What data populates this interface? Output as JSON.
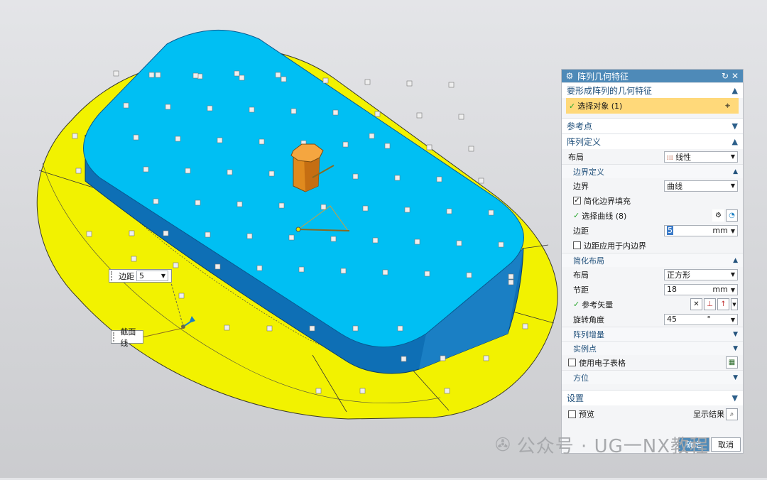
{
  "dialog": {
    "title": "阵列几何特征",
    "sections": {
      "features": "要形成阵列的几何特征",
      "select_object": "选择对象 (1)",
      "reference_point": "参考点",
      "array_definition": "阵列定义",
      "settings": "设置"
    },
    "layout": {
      "label": "布局",
      "value": "线性"
    },
    "boundary_def": {
      "title": "边界定义",
      "boundary_label": "边界",
      "boundary_value": "曲线",
      "simplify_fill": "简化边界填充",
      "simplify_fill_checked": true,
      "select_curve": "选择曲线 (8)",
      "margin_label": "边距",
      "margin_value": "5",
      "margin_unit": "mm",
      "apply_inner": "边距应用于内边界",
      "apply_inner_checked": false
    },
    "simple_layout": {
      "title": "简化布局",
      "layout_label": "布局",
      "layout_value": "正方形",
      "pitch_label": "节距",
      "pitch_value": "18",
      "pitch_unit": "mm",
      "ref_vector": "参考矢量",
      "rotation_label": "旋转角度",
      "rotation_value": "45",
      "rotation_unit": "°"
    },
    "array_increment": "阵列增量",
    "instance_point": "实例点",
    "use_spreadsheet": "使用电子表格",
    "orientation": "方位",
    "preview": "预览",
    "show_result": "显示结果",
    "ok": "确定",
    "cancel": "取消"
  },
  "viewport": {
    "margin_label": "边距",
    "margin_value": "5",
    "section_line_label": "截面线"
  },
  "watermark": "公众号 · UG一NX教程",
  "colors": {
    "title_bar": "#4e8ab8",
    "selected_row": "#ffd97a",
    "top_face": "#00bff3",
    "side_face": "#0e6fb5",
    "base": "#f2f200"
  }
}
